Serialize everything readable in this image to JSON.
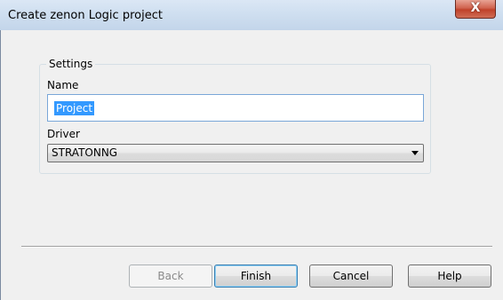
{
  "window": {
    "title": "Create zenon Logic project",
    "close_glyph": "X",
    "close_icon": "close-icon"
  },
  "settings": {
    "group_label": "Settings",
    "name_label": "Name",
    "name_value": "Project",
    "driver_label": "Driver",
    "driver_selected": "STRATONNG",
    "driver_dropdown_icon": "chevron-down-icon"
  },
  "buttons": {
    "back": "Back",
    "finish": "Finish",
    "cancel": "Cancel",
    "help": "Help"
  },
  "colors": {
    "selection_highlight": "#3399ff",
    "titlebar": "#cfdff0",
    "close_button": "#c0422a"
  }
}
